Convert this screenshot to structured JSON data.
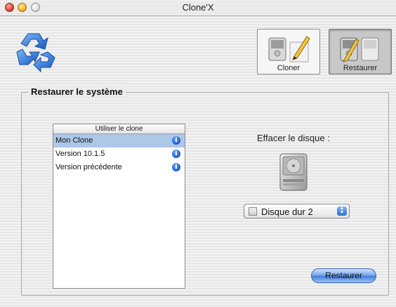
{
  "window": {
    "title": "Clone'X"
  },
  "toolbar": {
    "cloner_label": "Cloner",
    "restaurer_label": "Restaurer",
    "active_tool": "Restaurer"
  },
  "group": {
    "title": "Restaurer le système"
  },
  "clone_list": {
    "header": "Utiliser le clone",
    "items": [
      {
        "label": "Mon Clone",
        "selected": true,
        "icon": "info-icon"
      },
      {
        "label": "Version 10.1.5",
        "selected": false,
        "icon": "info-icon"
      },
      {
        "label": "Version précédente",
        "selected": false,
        "icon": "info-icon"
      }
    ]
  },
  "erase": {
    "label": "Effacer le disque :",
    "disk_icon": "hard-disk-icon",
    "selected_disk": "Disque dur 2"
  },
  "actions": {
    "restore_label": "Restaurer"
  },
  "colors": {
    "selection": "#adc7e6",
    "aqua_blue": "#3f7ad6",
    "info_blue": "#1a56c8",
    "logo_blue": "#2a7ad6"
  }
}
